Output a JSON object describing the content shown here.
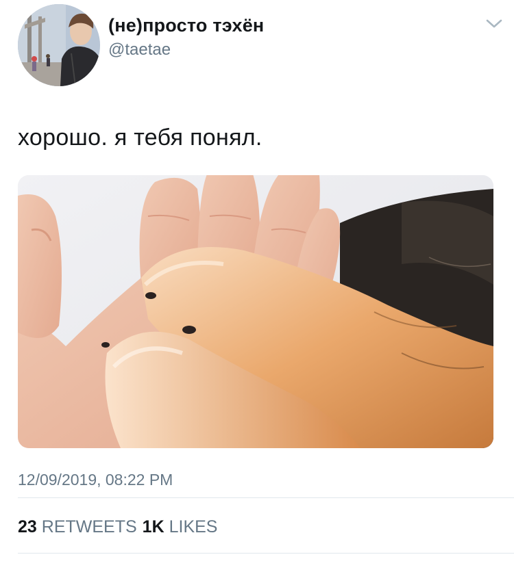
{
  "author": {
    "display_name": "(не)просто тэхён",
    "handle": "@taetae",
    "avatar_icon": "profile-photo",
    "menu_icon": "chevron-down-icon"
  },
  "tweet": {
    "text": "хорошо. я тебя понял.",
    "media_description_icon": "hand-and-dog-paws-photo",
    "timestamp": "12/09/2019, 08:22 PM"
  },
  "stats": {
    "retweets_count": "23",
    "retweets_label": "RETWEETS",
    "likes_count": "1K",
    "likes_label": "LIKES"
  },
  "colors": {
    "primary_text": "#14171a",
    "secondary_text": "#657786",
    "divider": "#e1e8ed"
  }
}
